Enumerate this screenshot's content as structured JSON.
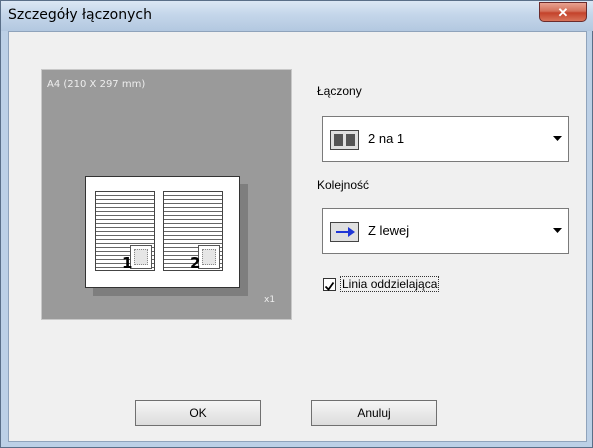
{
  "window": {
    "title": "Szczegóły łączonych",
    "close_glyph": "✕"
  },
  "preview": {
    "paper_size": "A4  (210 X 297 mm)",
    "copies": "x1",
    "page_numbers": [
      "1",
      "2"
    ]
  },
  "combine": {
    "label": "Łączony",
    "value": "2 na 1",
    "icon": "two-pages-icon"
  },
  "order": {
    "label": "Kolejność",
    "value": "Z lewej",
    "icon": "arrow-right-icon"
  },
  "separator": {
    "label": "Linia oddzielająca",
    "checked": true
  },
  "buttons": {
    "ok": "OK",
    "cancel": "Anuluj"
  },
  "colors": {
    "arrow_blue": "#1f36d6",
    "preview_bg": "#9a9a9a"
  }
}
